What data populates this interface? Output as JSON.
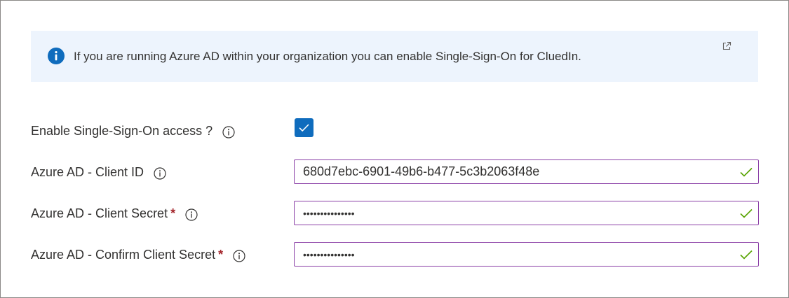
{
  "info": {
    "message": "If you are running Azure AD within your organization you can enable Single-Sign-On for CluedIn.",
    "icon": "info-icon",
    "link_icon": "external-link-icon"
  },
  "form": {
    "sso": {
      "label": "Enable Single-Sign-On access ?",
      "checked": true
    },
    "client_id": {
      "label": "Azure AD - Client ID",
      "value": "680d7ebc-6901-49b6-b477-5c3b2063f48e"
    },
    "client_secret": {
      "label": "Azure AD - Client Secret",
      "required_mark": "*",
      "value": "abcdefghijklmno"
    },
    "confirm_secret": {
      "label": "Azure AD - Confirm Client Secret",
      "required_mark": "*",
      "value": "abcdefghijklmno"
    }
  },
  "colors": {
    "accent": "#0f6cbd",
    "info_background": "#edf4fd",
    "field_border": "#8a3ea6",
    "valid_check": "#57a300",
    "required": "#a4262c"
  }
}
